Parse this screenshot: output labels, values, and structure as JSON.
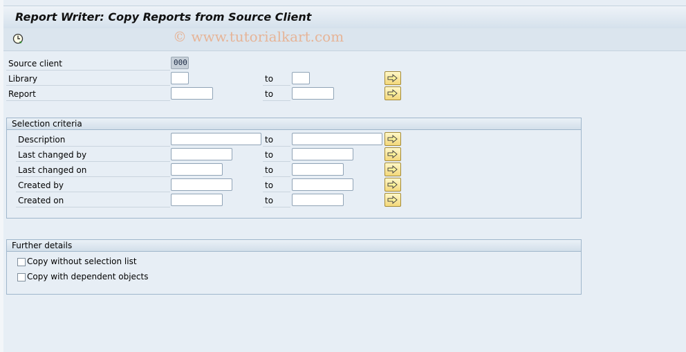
{
  "window": {
    "title": "Report Writer: Copy Reports from Source Client"
  },
  "toolbar": {
    "execute_icon": "execute-clock-icon",
    "watermark": "© www.tutorialkart.com"
  },
  "fields": {
    "source_client": {
      "label": "Source client",
      "value": "000"
    },
    "library": {
      "label": "Library",
      "to_label": "to",
      "from_value": "",
      "to_value": ""
    },
    "report": {
      "label": "Report",
      "to_label": "to",
      "from_value": "",
      "to_value": ""
    }
  },
  "selection_criteria": {
    "title": "Selection criteria",
    "rows": [
      {
        "label": "Description",
        "to_label": "to"
      },
      {
        "label": "Last changed by",
        "to_label": "to"
      },
      {
        "label": "Last changed on",
        "to_label": "to"
      },
      {
        "label": "Created by",
        "to_label": "to"
      },
      {
        "label": "Created on",
        "to_label": "to"
      }
    ]
  },
  "further_details": {
    "title": "Further details",
    "options": [
      {
        "label": "Copy without selection list",
        "checked": false
      },
      {
        "label": "Copy with dependent objects",
        "checked": false
      }
    ]
  },
  "colors": {
    "background": "#e7eef5",
    "multi_select_button": "#f3d77a"
  }
}
